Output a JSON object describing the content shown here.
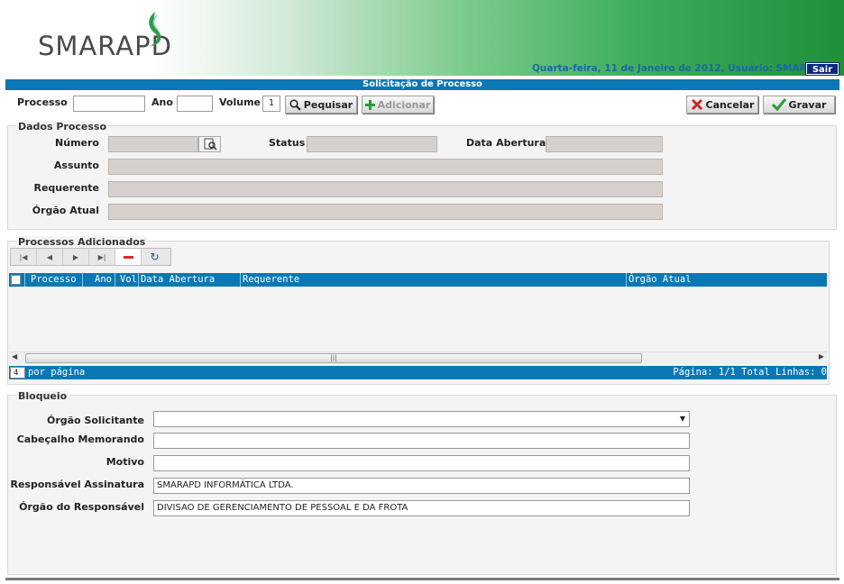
{
  "header": {
    "logo": "SMARAPD",
    "status": "Quarta-feira, 11 de Janeiro de 2012, Usuário: SMAR",
    "sair": "Sair"
  },
  "title": "Solicitação de Processo",
  "search": {
    "processo_label": "Processo",
    "processo_value": "",
    "ano_label": "Ano",
    "ano_value": "",
    "volume_label": "Volume",
    "volume_value": "1",
    "pesquisar": "Pequisar",
    "adicionar": "Adicionar",
    "cancelar": "Cancelar",
    "gravar": "Gravar"
  },
  "dados": {
    "title": "Dados Processo",
    "numero": "Número",
    "status": "Status",
    "data_abertura": "Data Abertura",
    "assunto": "Assunto",
    "requerente": "Requerente",
    "orgao_atual": "Órgão Atual"
  },
  "processos": {
    "title": "Processos Adicionados",
    "columns": [
      "Processo",
      "Ano",
      "Vol",
      "Data Abertura",
      "Requerente",
      "Órgão Atual"
    ],
    "per_page_value": "4",
    "per_page_label": "por página",
    "pagination": "Página: 1/1 Total Linhas: 0"
  },
  "bloqueio": {
    "title": "Bloqueio",
    "orgao_solicitante": "Órgão Solicitante",
    "orgao_solicitante_value": "",
    "cabecalho": "Cabeçalho Memorando",
    "cabecalho_value": "",
    "motivo": "Motivo",
    "motivo_value": "",
    "responsavel": "Responsável Assinatura",
    "responsavel_value": "SMARAPD INFORMÁTICA LTDA.",
    "orgao_responsavel": "Órgão do Responsável",
    "orgao_responsavel_value": "DIVISAO DE GERENCIAMENTO DE PESSOAL E DA FROTA"
  },
  "colors": {
    "primary_blue": "#0b78b5",
    "brand_green": "#1f8f3a",
    "cancel_red": "#c62828"
  },
  "icons": [
    "leaf-logo-icon",
    "magnifier-icon",
    "plus-icon",
    "x-icon",
    "checkmark-icon",
    "first-page-icon",
    "prev-page-icon",
    "next-page-icon",
    "last-page-icon",
    "remove-icon",
    "refresh-icon",
    "dropdown-arrow-icon"
  ]
}
